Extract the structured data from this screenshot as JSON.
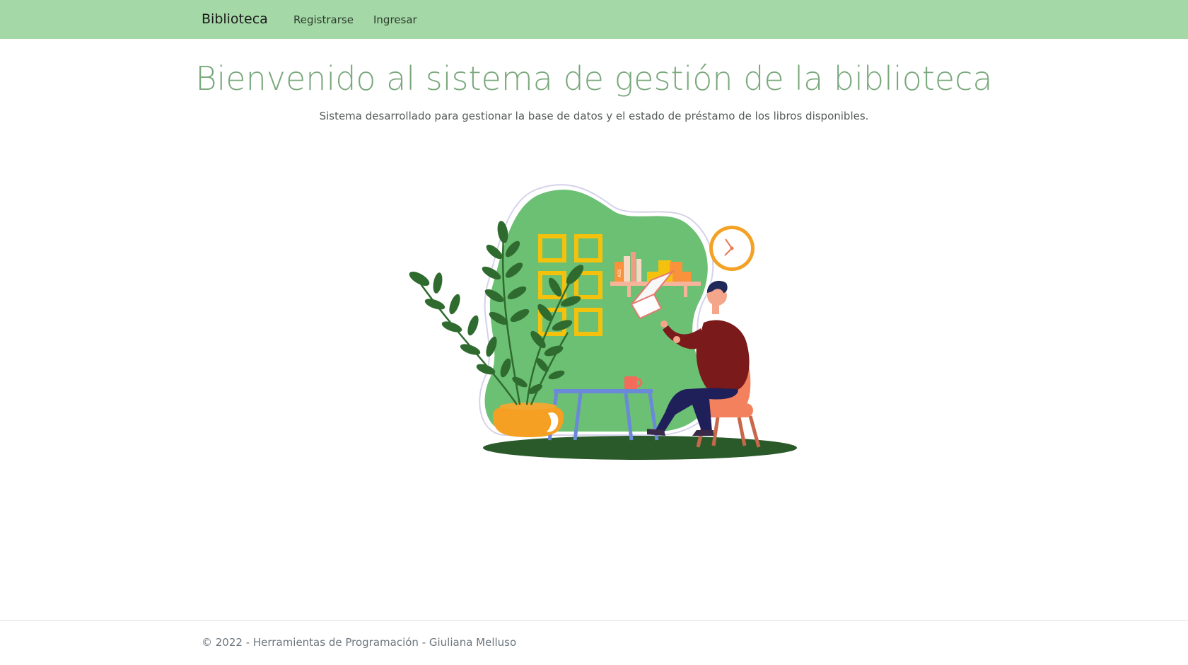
{
  "navbar": {
    "brand": "Biblioteca",
    "links": [
      {
        "label": "Registrarse"
      },
      {
        "label": "Ingresar"
      }
    ],
    "background": "#a5d8a7"
  },
  "hero": {
    "title": "Bienvenido al sistema de gestión de la biblioteca",
    "subtitle": "Sistema desarrollado para gestionar la base de datos y el estado de préstamo de los libros disponibles.",
    "title_color": "#7aa87c"
  },
  "illustration": {
    "icon": "person-reading-illustration",
    "book_spine_text": "ASS"
  },
  "footer": {
    "text": "© 2022 - Herramientas de Programación - Giuliana Melluso"
  }
}
